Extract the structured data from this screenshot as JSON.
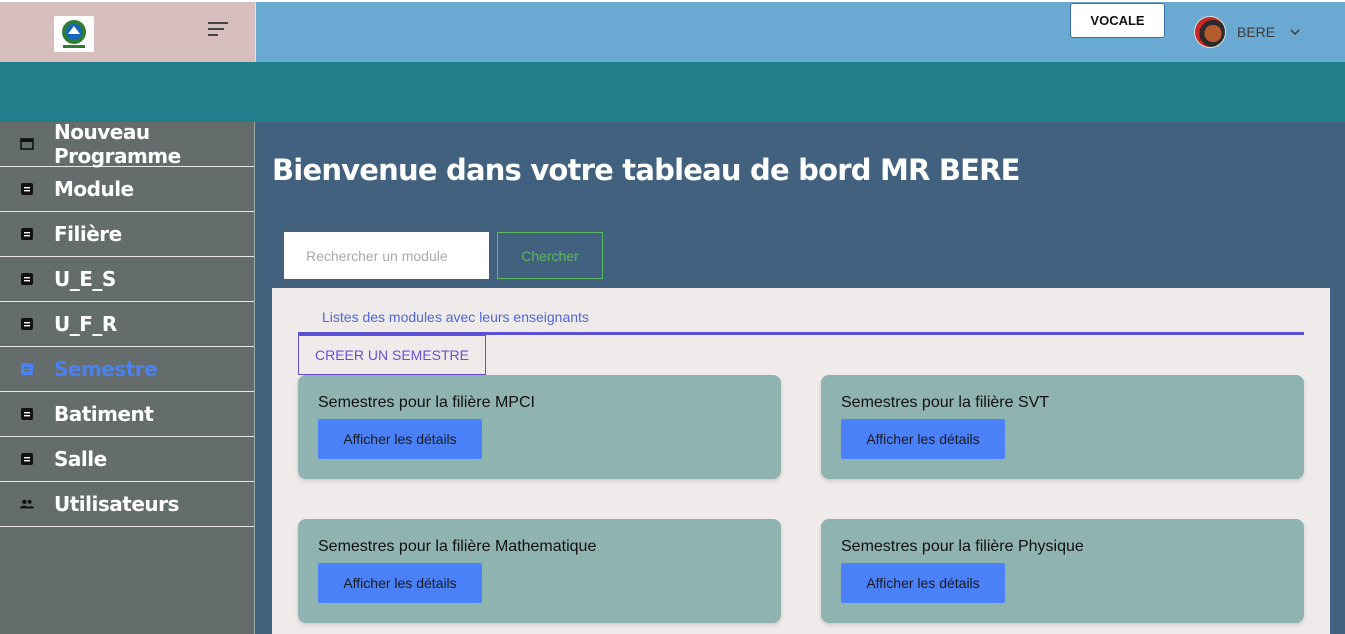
{
  "header": {
    "vocale_label": "VOCALE",
    "user_name": "BERE"
  },
  "sidebar": {
    "items": [
      {
        "label": "Nouveau Programme",
        "icon": "window-icon"
      },
      {
        "label": "Module",
        "icon": "list-icon"
      },
      {
        "label": "Filière",
        "icon": "list-icon"
      },
      {
        "label": "U_E_S",
        "icon": "list-icon"
      },
      {
        "label": "U_F_R",
        "icon": "list-icon"
      },
      {
        "label": "Semestre",
        "icon": "list-icon",
        "active": true
      },
      {
        "label": "Batiment",
        "icon": "list-icon"
      },
      {
        "label": "Salle",
        "icon": "list-icon"
      },
      {
        "label": "Utilisateurs",
        "icon": "users-icon"
      }
    ]
  },
  "main": {
    "welcome": "Bienvenue dans votre tableau de bord MR BERE",
    "search": {
      "placeholder": "Rechercher un module",
      "button_label": "Chercher"
    },
    "tab_label": "Listes des modules avec leurs enseignants",
    "create_button_label": "CREER UN SEMESTRE",
    "cards": [
      {
        "title": "Semestres pour la filière MPCI",
        "button": "Afficher les détails"
      },
      {
        "title": "Semestres pour la filière SVT",
        "button": "Afficher les détails"
      },
      {
        "title": "Semestres pour la filière Mathematique",
        "button": "Afficher les détails"
      },
      {
        "title": "Semestres pour la filière Physique",
        "button": "Afficher les détails"
      }
    ]
  },
  "colors": {
    "active_accent": "#4a80f0",
    "button_blue": "#4a80f8",
    "card_bg": "#8fb3b0",
    "teal_band": "#207f8b",
    "main_bg": "#41617f"
  }
}
